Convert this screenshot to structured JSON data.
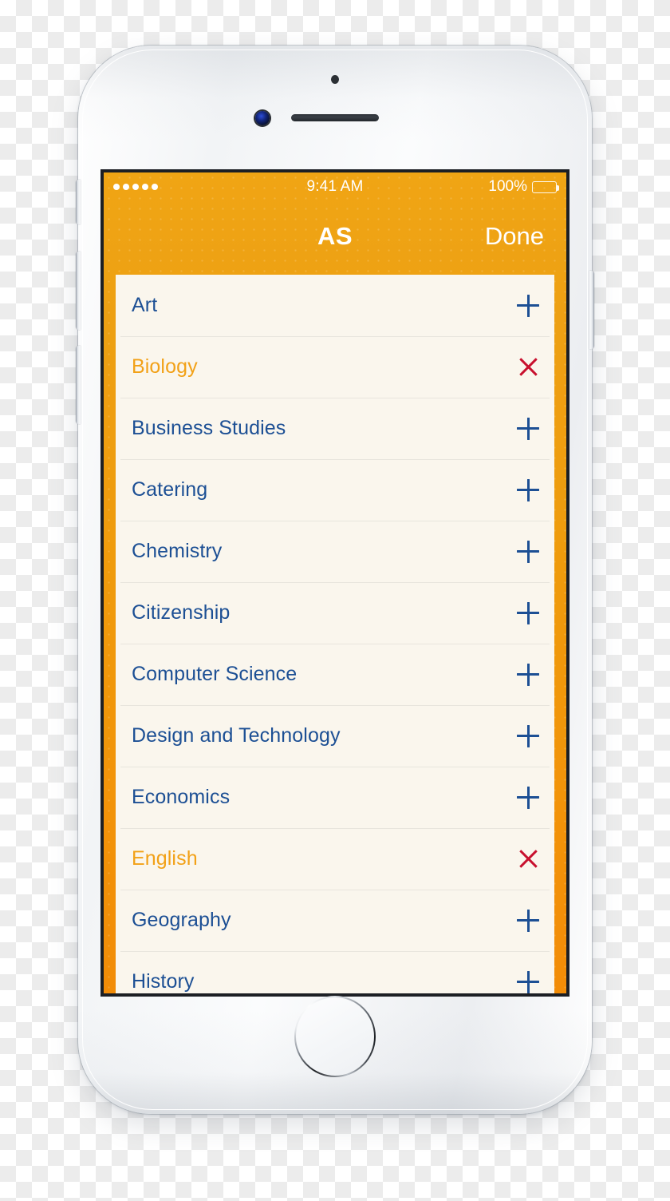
{
  "device": {
    "name": "iPhone",
    "color": "silver-white",
    "icons": {
      "sensor": "proximity-sensor-dot",
      "camera": "front-camera-icon",
      "earpiece": "earpiece-speaker",
      "home": "home-button",
      "mute": "mute-switch",
      "volume_up": "volume-up-button",
      "volume_down": "volume-down-button",
      "power": "power-button"
    }
  },
  "status_bar": {
    "signal_dots": 5,
    "time": "9:41 AM",
    "battery_percent": "100%",
    "battery_level": 100,
    "battery_icon": "battery-full-icon"
  },
  "nav_bar": {
    "title": "AS",
    "done_label": "Done"
  },
  "theme": {
    "accent_orange": "#f0a514",
    "accent_orange_dark": "#f28c07",
    "card_bg": "#faf6ed",
    "link_blue": "#1c4f94",
    "selected_orange": "#f2a117",
    "remove_red": "#c8102e",
    "separator": "#e8e5dd"
  },
  "subject_list": {
    "add_icon": "plus-icon",
    "remove_icon": "cross-icon",
    "items": [
      {
        "label": "Art",
        "selected": false,
        "icon": "plus-icon"
      },
      {
        "label": "Biology",
        "selected": true,
        "icon": "cross-icon"
      },
      {
        "label": "Business Studies",
        "selected": false,
        "icon": "plus-icon"
      },
      {
        "label": "Catering",
        "selected": false,
        "icon": "plus-icon"
      },
      {
        "label": "Chemistry",
        "selected": false,
        "icon": "plus-icon"
      },
      {
        "label": "Citizenship",
        "selected": false,
        "icon": "plus-icon"
      },
      {
        "label": "Computer Science",
        "selected": false,
        "icon": "plus-icon"
      },
      {
        "label": "Design and Technology",
        "selected": false,
        "icon": "plus-icon"
      },
      {
        "label": "Economics",
        "selected": false,
        "icon": "plus-icon"
      },
      {
        "label": "English",
        "selected": true,
        "icon": "cross-icon"
      },
      {
        "label": "Geography",
        "selected": false,
        "icon": "plus-icon"
      },
      {
        "label": "History",
        "selected": false,
        "icon": "plus-icon"
      }
    ]
  }
}
